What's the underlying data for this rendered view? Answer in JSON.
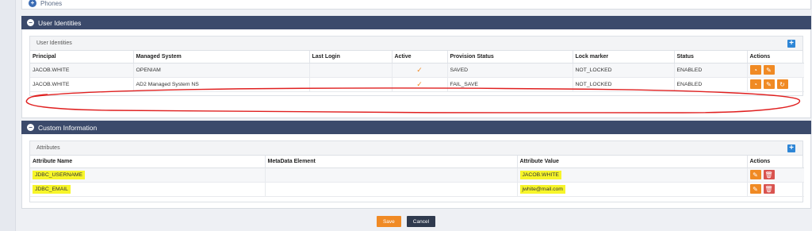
{
  "phones": {
    "label": "Phones"
  },
  "identities": {
    "section_title": "User Identities",
    "panel_title": "User Identities",
    "columns": [
      "Principal",
      "Managed System",
      "Last Login",
      "Active",
      "Provision Status",
      "Lock marker",
      "Status",
      "Actions"
    ],
    "rows": [
      {
        "principal": "JACOB.WHITE",
        "managed_system": "OPENIAM",
        "last_login": "",
        "active": "✓",
        "provision_status": "SAVED",
        "lock_marker": "NOT_LOCKED",
        "status": "ENABLED"
      },
      {
        "principal": "JACOB.WHITE",
        "managed_system": "AD2 Managed System NS",
        "last_login": "",
        "active": "✓",
        "provision_status": "FAIL_SAVE",
        "lock_marker": "NOT_LOCKED",
        "status": "ENABLED"
      }
    ]
  },
  "custom": {
    "section_title": "Custom Information",
    "panel_title": "Attributes",
    "columns": [
      "Attribute Name",
      "MetaData Element",
      "Attribute Value",
      "Actions"
    ],
    "rows": [
      {
        "name": "JDBC_USERNAME",
        "metadata": "",
        "value": "JACOB.WHITE"
      },
      {
        "name": "JDBC_EMAIL",
        "metadata": "",
        "value": "jwhite@mail.com"
      }
    ]
  },
  "buttons": {
    "save": "Save",
    "cancel": "Cancel"
  },
  "colors": {
    "header": "#3b4a6b",
    "accent": "#f08a24",
    "danger": "#d9534f",
    "add": "#2e86d6",
    "highlight": "#f7f52a",
    "annotation": "#e02020"
  }
}
